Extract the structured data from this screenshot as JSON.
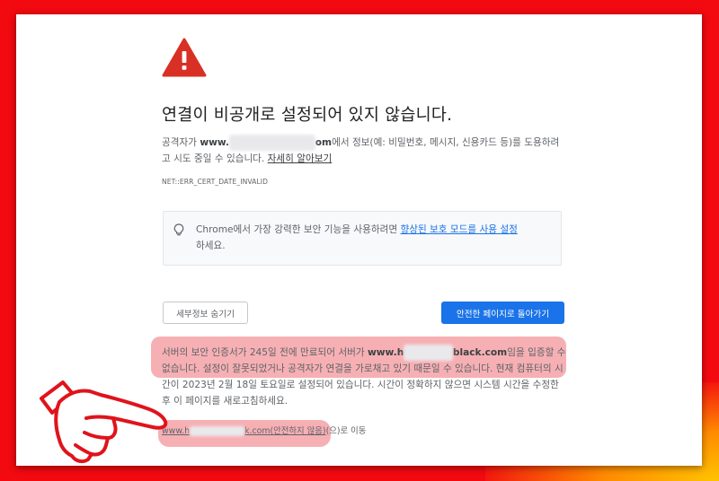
{
  "colors": {
    "background": "#f20a10",
    "warning_red": "#d93025",
    "primary_blue": "#1a73e8",
    "highlight": "#ee7076"
  },
  "icons": {
    "warning": "warning-triangle-icon",
    "tip": "lightbulb-icon",
    "pointer": "pointing-hand-icon"
  },
  "error": {
    "title": "연결이 비공개로 설정되어 있지 않습니다.",
    "desc_prefix": "공격자가 ",
    "domain_start": "www.",
    "domain_end": "om",
    "desc_middle": "에서 정보(예: 비밀번호, 메시지, 신용카드 등)를 도용하려고 시도 중일 수 있습니다. ",
    "learn_more": "자세히 알아보기",
    "error_code": "NET::ERR_CERT_DATE_INVALID"
  },
  "tip": {
    "text_before": "Chrome에서 가장 강력한 보안 기능을 사용하려면 ",
    "link": "향상된 보호 모드를 사용 설정",
    "text_after": "하세요."
  },
  "buttons": {
    "hide_details": "세부정보 숨기기",
    "back_to_safety": "안전한 페이지로 돌아가기"
  },
  "details": {
    "part1": "서버의 보안 인증서가 245일 전에 만료되어 서버가 ",
    "domain_start": "www.h",
    "domain_end": "black.com",
    "part2": "임을 입증할 수 없습니다. 설정이 잘못되었거나 공격자가 연결을 가로채고 있기 때문일 수 있습니다. 현재 컴퓨터의 시간이 2023년 2월 18일 토요일로 설정되어 있습니다. 시간이 정확하지 않으면 시스템 시간을 수정한 후 이 페이지를 새로고침하세요."
  },
  "proceed": {
    "link_start": "www.h",
    "link_end": "k.com(안전하지 않음)",
    "suffix": "(으)로 이동"
  }
}
